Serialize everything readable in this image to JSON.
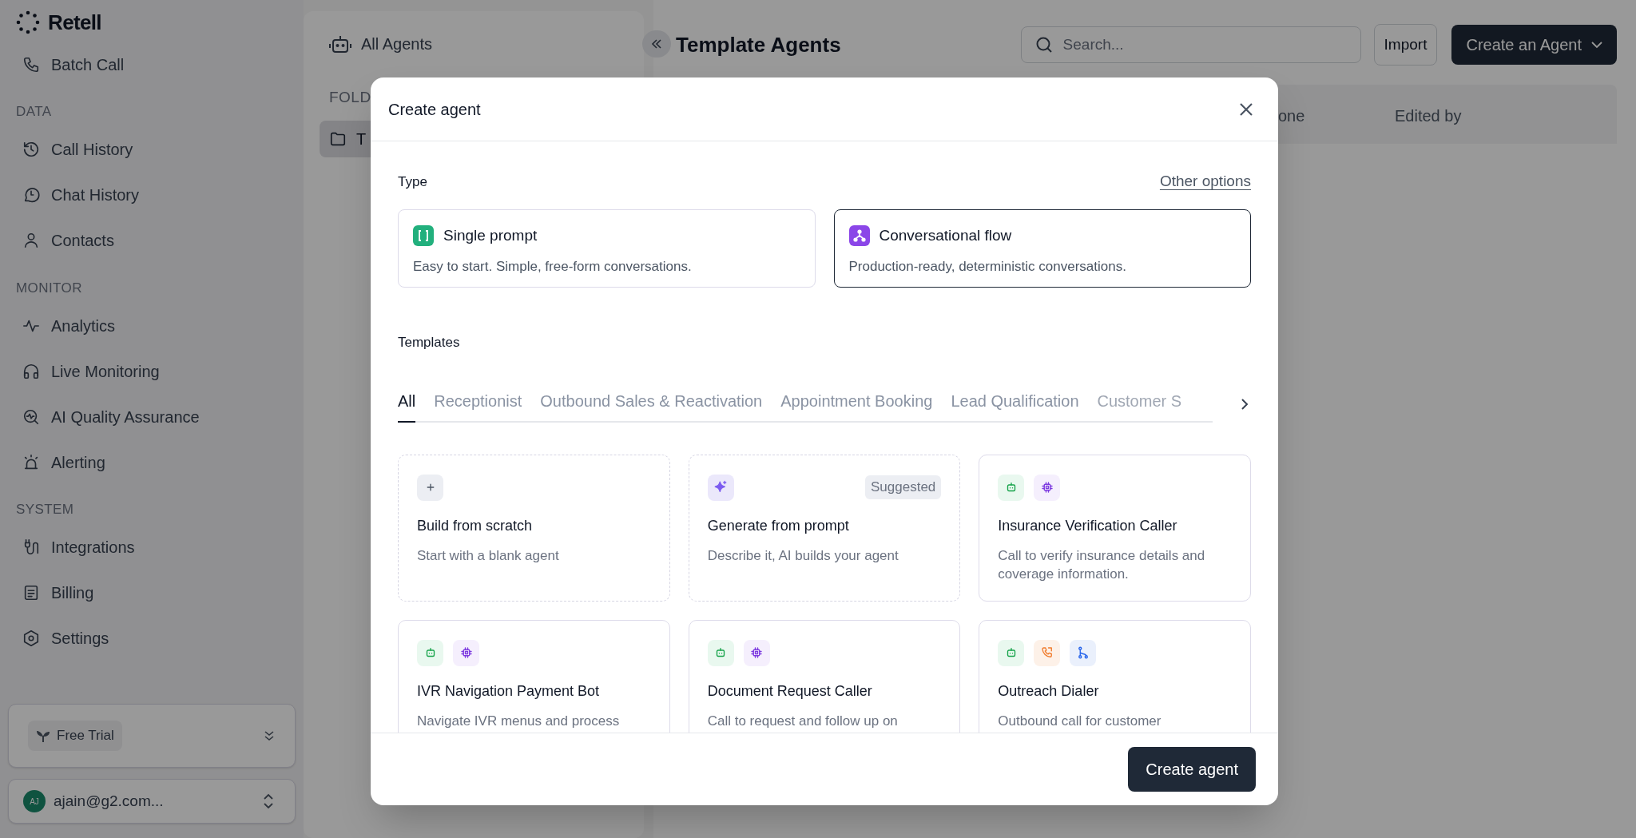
{
  "sidebar": {
    "logo": "Retell",
    "items": [
      {
        "kind": "item",
        "label": "Batch Call"
      },
      {
        "kind": "heading",
        "label": "DATA"
      },
      {
        "kind": "item",
        "label": "Call History"
      },
      {
        "kind": "item",
        "label": "Chat History"
      },
      {
        "kind": "item",
        "label": "Contacts"
      },
      {
        "kind": "heading",
        "label": "MONITOR"
      },
      {
        "kind": "item",
        "label": "Analytics"
      },
      {
        "kind": "item",
        "label": "Live Monitoring"
      },
      {
        "kind": "item",
        "label": "AI Quality Assurance"
      },
      {
        "kind": "item",
        "label": "Alerting"
      },
      {
        "kind": "heading",
        "label": "SYSTEM"
      },
      {
        "kind": "item",
        "label": "Integrations"
      },
      {
        "kind": "item",
        "label": "Billing"
      },
      {
        "kind": "item",
        "label": "Settings"
      }
    ],
    "plan": "Free Trial",
    "account": {
      "initials": "AJ",
      "email": "ajain@g2.com..."
    }
  },
  "folders_panel": {
    "title": "All Agents",
    "heading": "FOLD",
    "folders": [
      {
        "label": "T",
        "selected": true
      }
    ]
  },
  "main": {
    "title": "Template Agents",
    "search": {
      "placeholder": "Search..."
    },
    "import_button": "Import",
    "create_button": "Create an Agent",
    "table": {
      "columns": [
        "one",
        "Edited by"
      ]
    }
  },
  "dialog": {
    "title": "Create agent",
    "type_label": "Type",
    "other_options": "Other options",
    "types": [
      {
        "kind": "single",
        "title": "Single prompt",
        "description": "Easy to start. Simple, free-form conversations.",
        "selected": false
      },
      {
        "kind": "flow",
        "title": "Conversational flow",
        "description": "Production-ready, deterministic conversations.",
        "selected": true
      }
    ],
    "templates_label": "Templates",
    "tabs": [
      {
        "label": "All",
        "selected": true
      },
      {
        "label": "Receptionist",
        "selected": false
      },
      {
        "label": "Outbound Sales & Reactivation",
        "selected": false
      },
      {
        "label": "Appointment Booking",
        "selected": false
      },
      {
        "label": "Lead Qualification",
        "selected": false
      },
      {
        "label": "Customer S",
        "selected": false
      }
    ],
    "cards": [
      {
        "kind": "blank",
        "icons": [
          {
            "kind": "plus"
          }
        ],
        "title": "Build from scratch",
        "description": "Start with a blank agent"
      },
      {
        "kind": "blank",
        "icons": [
          {
            "kind": "sparkle"
          }
        ],
        "badge": "Suggested",
        "title": "Generate from prompt",
        "description": "Describe it, AI builds your agent"
      },
      {
        "kind": "template",
        "icons": [
          {
            "kind": "bot"
          },
          {
            "kind": "chip"
          }
        ],
        "title": "Insurance Verification Caller",
        "description": "Call to verify insurance details and coverage information."
      },
      {
        "kind": "template",
        "icons": [
          {
            "kind": "bot"
          },
          {
            "kind": "chip"
          }
        ],
        "title": "IVR Navigation Payment Bot",
        "description": "Navigate IVR menus and process"
      },
      {
        "kind": "template",
        "icons": [
          {
            "kind": "bot"
          },
          {
            "kind": "chip"
          }
        ],
        "title": "Document Request Caller",
        "description": "Call to request and follow up on"
      },
      {
        "kind": "template",
        "icons": [
          {
            "kind": "bot"
          },
          {
            "kind": "phone"
          },
          {
            "kind": "branch"
          }
        ],
        "title": "Outreach Dialer",
        "description": "Outbound call for customer"
      }
    ],
    "submit_button": "Create agent"
  }
}
